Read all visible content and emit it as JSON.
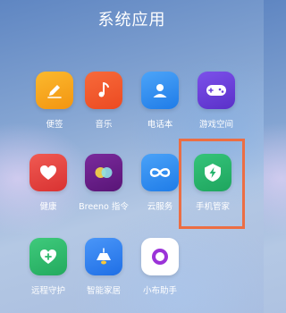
{
  "folder": {
    "title": "系统应用"
  },
  "apps": [
    {
      "label": "便签",
      "icon": "pencil-note-icon",
      "color": "#f6a21b"
    },
    {
      "label": "音乐",
      "icon": "music-note-icon",
      "color": "#f1542a"
    },
    {
      "label": "电话本",
      "icon": "contact-person-icon",
      "color": "#2f8ef2"
    },
    {
      "label": "游戏空间",
      "icon": "gamepad-icon",
      "color": "#6a3fd8"
    },
    {
      "label": "健康",
      "icon": "heart-icon",
      "color": "#e8443f"
    },
    {
      "label": "Breeno 指令",
      "icon": "breeno-circles-icon",
      "color": "#6b1f8a"
    },
    {
      "label": "云服务",
      "icon": "cloud-infinity-icon",
      "color": "#2f8ef2"
    },
    {
      "label": "手机管家",
      "icon": "shield-bolt-icon",
      "color": "#23b36b"
    },
    {
      "label": "远程守护",
      "icon": "heart-shield-icon",
      "color": "#2db86a"
    },
    {
      "label": "智能家居",
      "icon": "smart-lamp-icon",
      "color": "#2f7ff0"
    },
    {
      "label": "小布助手",
      "icon": "ring-dot-icon",
      "color": "#ffffff"
    }
  ],
  "highlight": {
    "target": "手机管家",
    "color": "#ec6e43"
  }
}
